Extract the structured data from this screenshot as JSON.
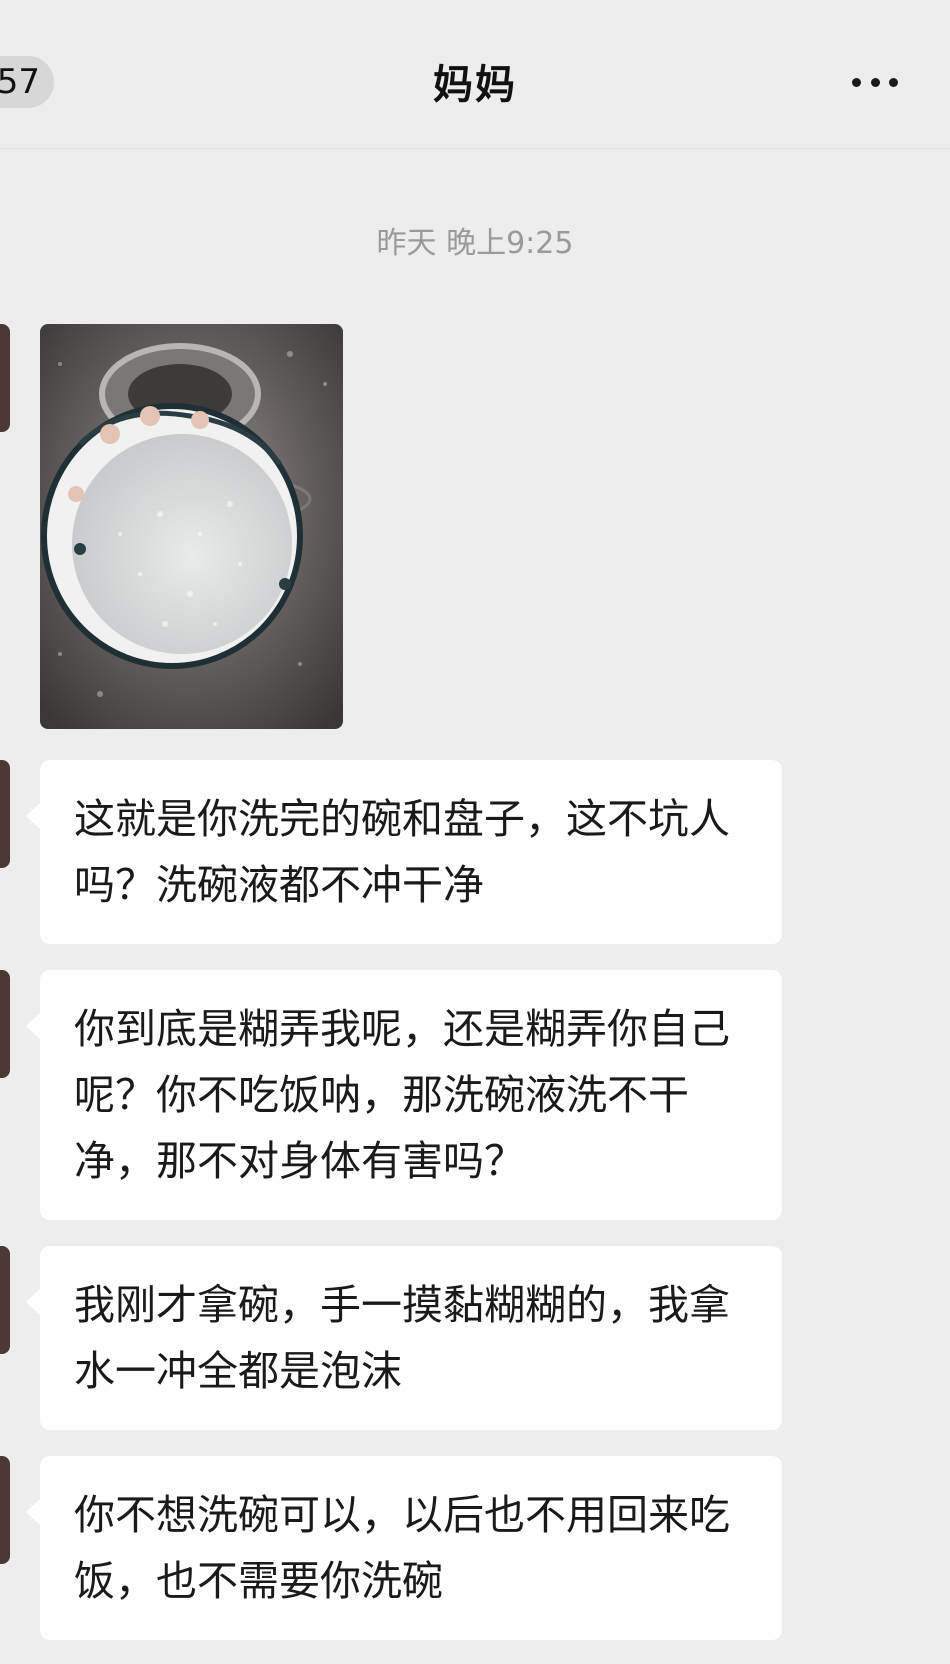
{
  "header": {
    "back_count": "57",
    "title": "妈妈",
    "more_icon": "more-dots-icon"
  },
  "chat": {
    "timestamp": "昨天 晚上9:25",
    "photo": {
      "description_icon": "photo-bowl-in-sink"
    },
    "messages": [
      {
        "text": "这就是你洗完的碗和盘子，这不坑人吗？洗碗液都不冲干净"
      },
      {
        "text": "你到底是糊弄我呢，还是糊弄你自己呢？你不吃饭呐，那洗碗液洗不干净，那不对身体有害吗？"
      },
      {
        "text": "我刚才拿碗，手一摸黏糊糊的，我拿水一冲全都是泡沫"
      },
      {
        "text": "你不想洗碗可以，以后也不用回来吃饭，也不需要你洗碗"
      }
    ]
  },
  "colors": {
    "background": "#ededed",
    "bubble": "#ffffff",
    "avatar": "#4a3a33"
  }
}
